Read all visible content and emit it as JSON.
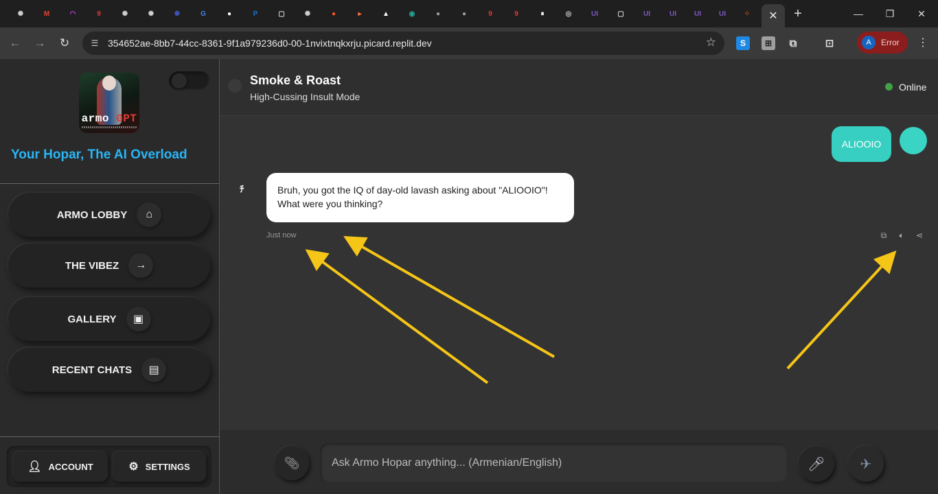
{
  "browser": {
    "tabs": [
      {
        "icon": "openai-icon",
        "color": "#d0d0d0",
        "glyph": "✺"
      },
      {
        "icon": "gmail-icon",
        "color": "#ea4335",
        "glyph": "M"
      },
      {
        "icon": "arc-icon",
        "color": "#e040fb",
        "glyph": "◠"
      },
      {
        "icon": "app-9-icon",
        "color": "#e53935",
        "glyph": "9"
      },
      {
        "icon": "openai-icon",
        "color": "#d0d0d0",
        "glyph": "✺"
      },
      {
        "icon": "openai-icon",
        "color": "#d0d0d0",
        "glyph": "✺"
      },
      {
        "icon": "perplexity-icon",
        "color": "#3f51b5",
        "glyph": "✺"
      },
      {
        "icon": "google-icon",
        "color": "#4285f4",
        "glyph": "G"
      },
      {
        "icon": "github-icon",
        "color": "#ffffff",
        "glyph": "●"
      },
      {
        "icon": "paypal-icon",
        "color": "#1976d2",
        "glyph": "P"
      },
      {
        "icon": "doc-icon",
        "color": "#dddddd",
        "glyph": "▢"
      },
      {
        "icon": "openai-icon",
        "color": "#d0d0d0",
        "glyph": "✺"
      },
      {
        "icon": "reddit-icon",
        "color": "#ff5722",
        "glyph": "●"
      },
      {
        "icon": "play-icon",
        "color": "#ff7043",
        "glyph": "▸"
      },
      {
        "icon": "vercel-icon",
        "color": "#ffffff",
        "glyph": "▲"
      },
      {
        "icon": "spiral-icon",
        "color": "#26a69a",
        "glyph": "◉"
      },
      {
        "icon": "avatar-tab-icon",
        "color": "#9e9e9e",
        "glyph": "●"
      },
      {
        "icon": "avatar-tab-icon",
        "color": "#9e9e9e",
        "glyph": "●"
      },
      {
        "icon": "app-9-icon",
        "color": "#e53935",
        "glyph": "9"
      },
      {
        "icon": "app-9-round-icon",
        "color": "#e53935",
        "glyph": "9"
      },
      {
        "icon": "pause-icon",
        "color": "#ffffff",
        "glyph": "⏸"
      },
      {
        "icon": "chrome-icon",
        "color": "#cfcfcf",
        "glyph": "◎"
      },
      {
        "icon": "ui-icon",
        "color": "#7e57c2",
        "glyph": "UI"
      },
      {
        "icon": "doc-icon",
        "color": "#dddddd",
        "glyph": "▢"
      },
      {
        "icon": "ui-icon",
        "color": "#7e57c2",
        "glyph": "UI"
      },
      {
        "icon": "ui-icon",
        "color": "#7e57c2",
        "glyph": "UI"
      },
      {
        "icon": "ui-icon",
        "color": "#7e57c2",
        "glyph": "UI"
      },
      {
        "icon": "ui-icon",
        "color": "#7e57c2",
        "glyph": "UI"
      },
      {
        "icon": "replit-icon",
        "color": "#f26207",
        "glyph": "⁘"
      }
    ],
    "url": "354652ae-8bb7-44cc-8361-9f1a979236d0-00-1nvixtnqkxrju.picard.replit.dev",
    "profile_initial": "A",
    "profile_status": "Error"
  },
  "sidebar": {
    "logo_text_main": "armo",
    "logo_text_accent": "GPT",
    "tagline": "Your Hopar, The AI Overload",
    "nav": [
      {
        "label": "ARMO LOBBY",
        "icon": "⌂"
      },
      {
        "label": "THE VIBEZ",
        "icon": "→"
      },
      {
        "label": "GALLERY",
        "icon": "▣"
      },
      {
        "label": "RECENT CHATS",
        "icon": "▤"
      }
    ],
    "account_label": "ACCOUNT",
    "settings_label": "SETTINGS"
  },
  "chat": {
    "title": "Smoke & Roast",
    "subtitle": "High-Cussing Insult Mode",
    "status": "Online",
    "status_color": "#43a047",
    "accent_color": "#37cfc1",
    "messages": [
      {
        "role": "user",
        "text": "ALIOOIO"
      },
      {
        "role": "assistant",
        "text": "Bruh, you got the IQ of day-old lavash asking about \"ALIOOIO\"! What were you thinking?",
        "time": "Just now"
      }
    ],
    "input_placeholder": "Ask Armo Hopar anything... (Armenian/English)"
  }
}
